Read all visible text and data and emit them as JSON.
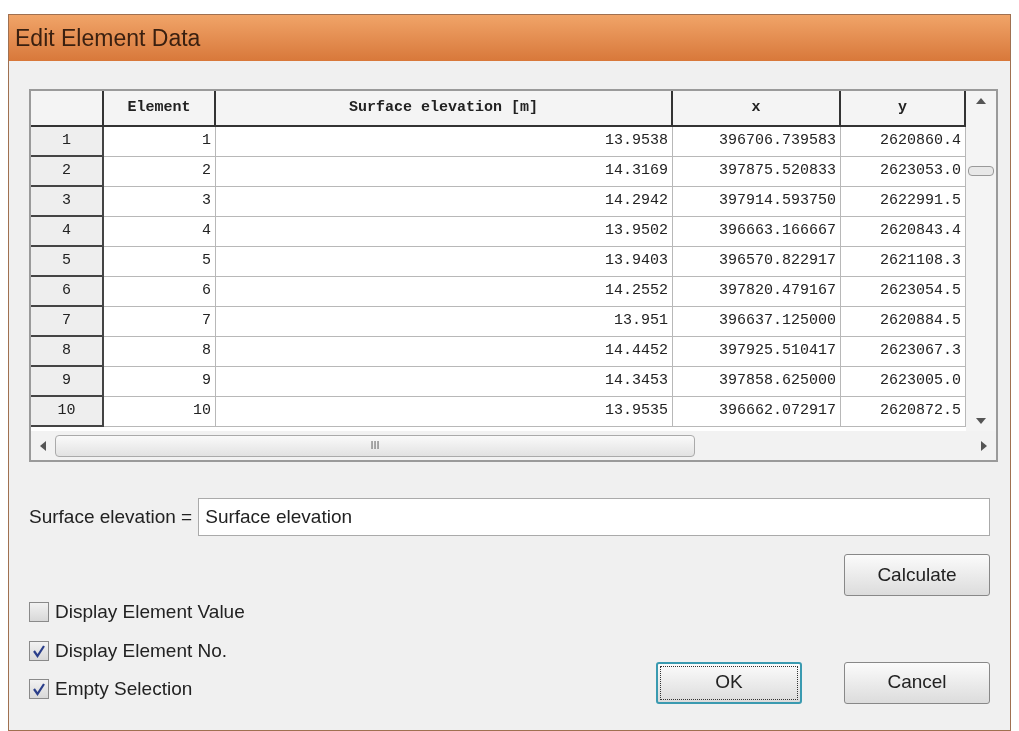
{
  "window": {
    "title": "Edit Element Data"
  },
  "table": {
    "columns": [
      "Element",
      "Surface elevation [m]",
      "x",
      "y"
    ],
    "rows": [
      {
        "header": "1",
        "cells": [
          "1",
          "13.9538",
          "396706.739583",
          "2620860.4"
        ]
      },
      {
        "header": "2",
        "cells": [
          "2",
          "14.3169",
          "397875.520833",
          "2623053.0"
        ]
      },
      {
        "header": "3",
        "cells": [
          "3",
          "14.2942",
          "397914.593750",
          "2622991.5"
        ]
      },
      {
        "header": "4",
        "cells": [
          "4",
          "13.9502",
          "396663.166667",
          "2620843.4"
        ]
      },
      {
        "header": "5",
        "cells": [
          "5",
          "13.9403",
          "396570.822917",
          "2621108.3"
        ]
      },
      {
        "header": "6",
        "cells": [
          "6",
          "14.2552",
          "397820.479167",
          "2623054.5"
        ]
      },
      {
        "header": "7",
        "cells": [
          "7",
          "13.951",
          "396637.125000",
          "2620884.5"
        ]
      },
      {
        "header": "8",
        "cells": [
          "8",
          "14.4452",
          "397925.510417",
          "2623067.3"
        ]
      },
      {
        "header": "9",
        "cells": [
          "9",
          "14.3453",
          "397858.625000",
          "2623005.0"
        ]
      },
      {
        "header": "10",
        "cells": [
          "10",
          "13.9535",
          "396662.072917",
          "2620872.5"
        ]
      }
    ],
    "scroll_grip": "III"
  },
  "formula": {
    "label": "Surface elevation =",
    "value": "Surface elevation"
  },
  "calculate_button": "Calculate",
  "checkboxes": [
    {
      "label": "Display Element Value",
      "checked": false
    },
    {
      "label": "Display Element No.",
      "checked": true
    },
    {
      "label": "Empty Selection",
      "checked": true
    }
  ],
  "buttons": [
    {
      "label": "OK",
      "selected": true
    },
    {
      "label": "Cancel",
      "selected": false
    }
  ]
}
